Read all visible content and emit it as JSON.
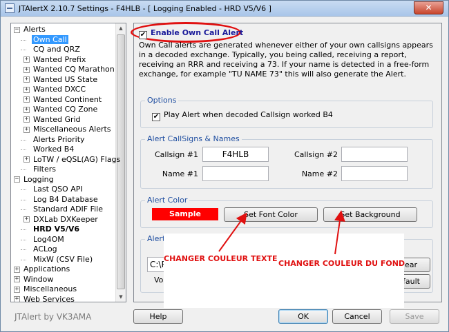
{
  "window": {
    "title": "JTAlertX 2.10.7 Settings   -   F4HLB   -   [ Logging Enabled - HRD V5/V6 ]",
    "close": "✕"
  },
  "tree": {
    "items": [
      {
        "label": "Alerts",
        "level": 0,
        "expander": "−"
      },
      {
        "label": "Own Call",
        "level": 1,
        "selected": true
      },
      {
        "label": "CQ and QRZ",
        "level": 1
      },
      {
        "label": "Wanted Prefix",
        "level": 1,
        "expander": "+"
      },
      {
        "label": "Wanted CQ Marathon",
        "level": 1,
        "expander": "+"
      },
      {
        "label": "Wanted US State",
        "level": 1,
        "expander": "+"
      },
      {
        "label": "Wanted DXCC",
        "level": 1,
        "expander": "+"
      },
      {
        "label": "Wanted Continent",
        "level": 1,
        "expander": "+"
      },
      {
        "label": "Wanted CQ Zone",
        "level": 1,
        "expander": "+"
      },
      {
        "label": "Wanted Grid",
        "level": 1,
        "expander": "+"
      },
      {
        "label": "Miscellaneous Alerts",
        "level": 1,
        "expander": "+"
      },
      {
        "label": "Alerts Priority",
        "level": 1
      },
      {
        "label": "Worked B4",
        "level": 1
      },
      {
        "label": "LoTW / eQSL(AG) Flags",
        "level": 1,
        "expander": "+"
      },
      {
        "label": "Filters",
        "level": 1
      },
      {
        "label": "Logging",
        "level": 0,
        "expander": "−"
      },
      {
        "label": "Last QSO API",
        "level": 1
      },
      {
        "label": "Log B4 Database",
        "level": 1
      },
      {
        "label": "Standard ADIF File",
        "level": 1
      },
      {
        "label": "DXLab DXKeeper",
        "level": 1,
        "expander": "+"
      },
      {
        "label": "HRD V5/V6",
        "level": 1,
        "bold": true
      },
      {
        "label": "Log4OM",
        "level": 1
      },
      {
        "label": "ACLog",
        "level": 1
      },
      {
        "label": "MixW (CSV File)",
        "level": 1
      },
      {
        "label": "Applications",
        "level": 0,
        "expander": "+"
      },
      {
        "label": "Window",
        "level": 0,
        "expander": "+"
      },
      {
        "label": "Miscellaneous",
        "level": 0,
        "expander": "+"
      },
      {
        "label": "Web Services",
        "level": 0,
        "expander": "+"
      }
    ]
  },
  "own_call": {
    "enable_label": "Enable Own Call Alert",
    "enabled": "✔",
    "description": "Own Call alerts are generated whenever either of your own callsigns appears in a decoded exchange. Typically, you being called, receiving a report, receiving an RRR and receiving a 73. If your name is detected in a free-form exchange, for example \"TU NAME 73\" this will also generate the Alert."
  },
  "options": {
    "title": "Options",
    "play_alert_label": "Play Alert when decoded Callsign worked B4",
    "play_alert_checked": "✔"
  },
  "callsigns": {
    "title": "Alert CallSigns & Names",
    "callsign1_label": "Callsign #1",
    "callsign1_value": "F4HLB",
    "callsign2_label": "Callsign #2",
    "callsign2_value": "",
    "name1_label": "Name #1",
    "name1_value": "",
    "name2_label": "Name #2",
    "name2_value": ""
  },
  "color": {
    "title": "Alert Color",
    "sample_label": "Sample",
    "sample_bg": "#ff0000",
    "set_font_label": "Set Font Color",
    "set_background_label": "Set Background"
  },
  "sound": {
    "title": "Alert",
    "path_value": "C:\\P",
    "volume_label": "Vol",
    "clear_label": "lear",
    "default_label": "fault"
  },
  "annotations": {
    "font_note": "CHANGER COULEUR TEXTE",
    "bg_note": "CHANGER COULEUR DU FOND",
    "color": "#e01010"
  },
  "footer": {
    "brand": "JTAlert by VK3AMA",
    "help": "Help",
    "ok": "OK",
    "cancel": "Cancel",
    "save": "Save"
  }
}
